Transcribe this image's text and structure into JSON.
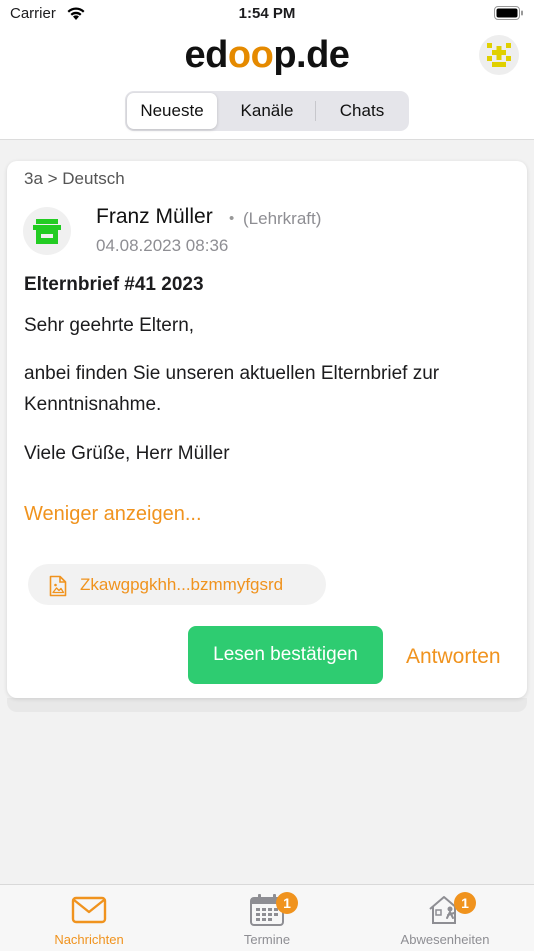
{
  "status_bar": {
    "carrier": "Carrier",
    "time": "1:54 PM"
  },
  "header": {
    "logo_prefix": "ed",
    "logo_accent": "oo",
    "logo_suffix": "p.de",
    "segments": [
      "Neueste",
      "Kanäle",
      "Chats"
    ],
    "active_segment": "Neueste"
  },
  "message": {
    "breadcrumb": "3a > Deutsch",
    "sender_name": "Franz Müller",
    "sender_dot": "•",
    "sender_role": "(Lehrkraft)",
    "date": "04.08.2023 08:36",
    "title": "Elternbrief #41 2023",
    "paragraphs": [
      "Sehr geehrte Eltern,",
      "anbei finden Sie unseren aktuellen Elternbrief zur Kenntnisnahme.",
      "Viele Grüße, Herr Müller"
    ],
    "toggle_label": "Weniger anzeigen...",
    "attachment_name": "Zkawgpgkhh...bzmmyfgsrd",
    "confirm_label": "Lesen bestätigen",
    "reply_label": "Antworten"
  },
  "tabbar": {
    "items": [
      {
        "label": "Nachrichten",
        "icon": "mail-icon",
        "badge": ""
      },
      {
        "label": "Termine",
        "icon": "calendar-icon",
        "badge": "1"
      },
      {
        "label": "Abwesenheiten",
        "icon": "house-person-icon",
        "badge": "1"
      }
    ],
    "active": "Nachrichten"
  },
  "colors": {
    "accent": "#f0931e",
    "confirm_green": "#2ecc71",
    "avatar_green": "#22cc22",
    "avatar_yellow": "#e0d000"
  }
}
